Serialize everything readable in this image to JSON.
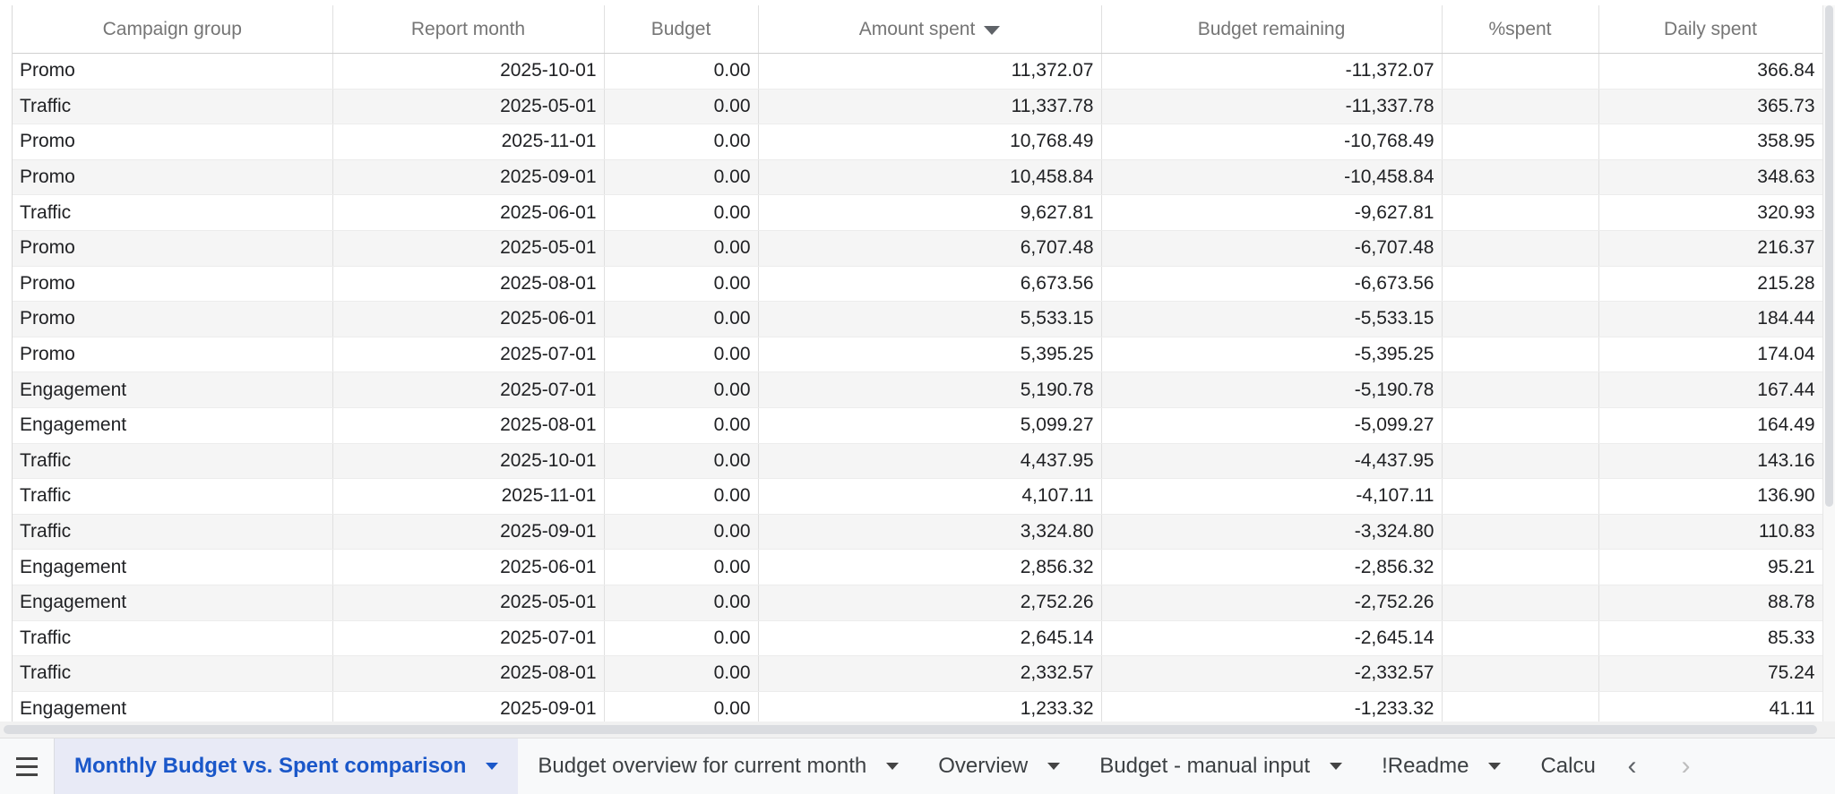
{
  "columns": [
    "Campaign group",
    "Report month",
    "Budget",
    "Amount spent",
    "Budget remaining",
    "%spent",
    "Daily spent"
  ],
  "sorted_column_index": 3,
  "rows": [
    [
      "Promo",
      "2025-10-01",
      "0.00",
      "11,372.07",
      "-11,372.07",
      "",
      "366.84"
    ],
    [
      "Traffic",
      "2025-05-01",
      "0.00",
      "11,337.78",
      "-11,337.78",
      "",
      "365.73"
    ],
    [
      "Promo",
      "2025-11-01",
      "0.00",
      "10,768.49",
      "-10,768.49",
      "",
      "358.95"
    ],
    [
      "Promo",
      "2025-09-01",
      "0.00",
      "10,458.84",
      "-10,458.84",
      "",
      "348.63"
    ],
    [
      "Traffic",
      "2025-06-01",
      "0.00",
      "9,627.81",
      "-9,627.81",
      "",
      "320.93"
    ],
    [
      "Promo",
      "2025-05-01",
      "0.00",
      "6,707.48",
      "-6,707.48",
      "",
      "216.37"
    ],
    [
      "Promo",
      "2025-08-01",
      "0.00",
      "6,673.56",
      "-6,673.56",
      "",
      "215.28"
    ],
    [
      "Promo",
      "2025-06-01",
      "0.00",
      "5,533.15",
      "-5,533.15",
      "",
      "184.44"
    ],
    [
      "Promo",
      "2025-07-01",
      "0.00",
      "5,395.25",
      "-5,395.25",
      "",
      "174.04"
    ],
    [
      "Engagement",
      "2025-07-01",
      "0.00",
      "5,190.78",
      "-5,190.78",
      "",
      "167.44"
    ],
    [
      "Engagement",
      "2025-08-01",
      "0.00",
      "5,099.27",
      "-5,099.27",
      "",
      "164.49"
    ],
    [
      "Traffic",
      "2025-10-01",
      "0.00",
      "4,437.95",
      "-4,437.95",
      "",
      "143.16"
    ],
    [
      "Traffic",
      "2025-11-01",
      "0.00",
      "4,107.11",
      "-4,107.11",
      "",
      "136.90"
    ],
    [
      "Traffic",
      "2025-09-01",
      "0.00",
      "3,324.80",
      "-3,324.80",
      "",
      "110.83"
    ],
    [
      "Engagement",
      "2025-06-01",
      "0.00",
      "2,856.32",
      "-2,856.32",
      "",
      "95.21"
    ],
    [
      "Engagement",
      "2025-05-01",
      "0.00",
      "2,752.26",
      "-2,752.26",
      "",
      "88.78"
    ],
    [
      "Traffic",
      "2025-07-01",
      "0.00",
      "2,645.14",
      "-2,645.14",
      "",
      "85.33"
    ],
    [
      "Traffic",
      "2025-08-01",
      "0.00",
      "2,332.57",
      "-2,332.57",
      "",
      "75.24"
    ],
    [
      "Engagement",
      "2025-09-01",
      "0.00",
      "1,233.32",
      "-1,233.32",
      "",
      "41.11"
    ]
  ],
  "tabs": [
    {
      "label": "Monthly Budget vs. Spent comparison",
      "active": true
    },
    {
      "label": "Budget overview for current month",
      "active": false
    },
    {
      "label": "Overview",
      "active": false
    },
    {
      "label": "Budget - manual input",
      "active": false
    },
    {
      "label": "!Readme",
      "active": false
    },
    {
      "label": "Calcu",
      "active": false
    }
  ],
  "icons": {
    "menu": "hamburger-icon",
    "prev": "chevron-left-icon",
    "next": "chevron-right-icon",
    "sort": "sort-desc-icon"
  },
  "colors": {
    "active_tab_text": "#1a57c9",
    "active_tab_bg": "#e8eaf6",
    "row_alt": "#f5f5f5"
  }
}
